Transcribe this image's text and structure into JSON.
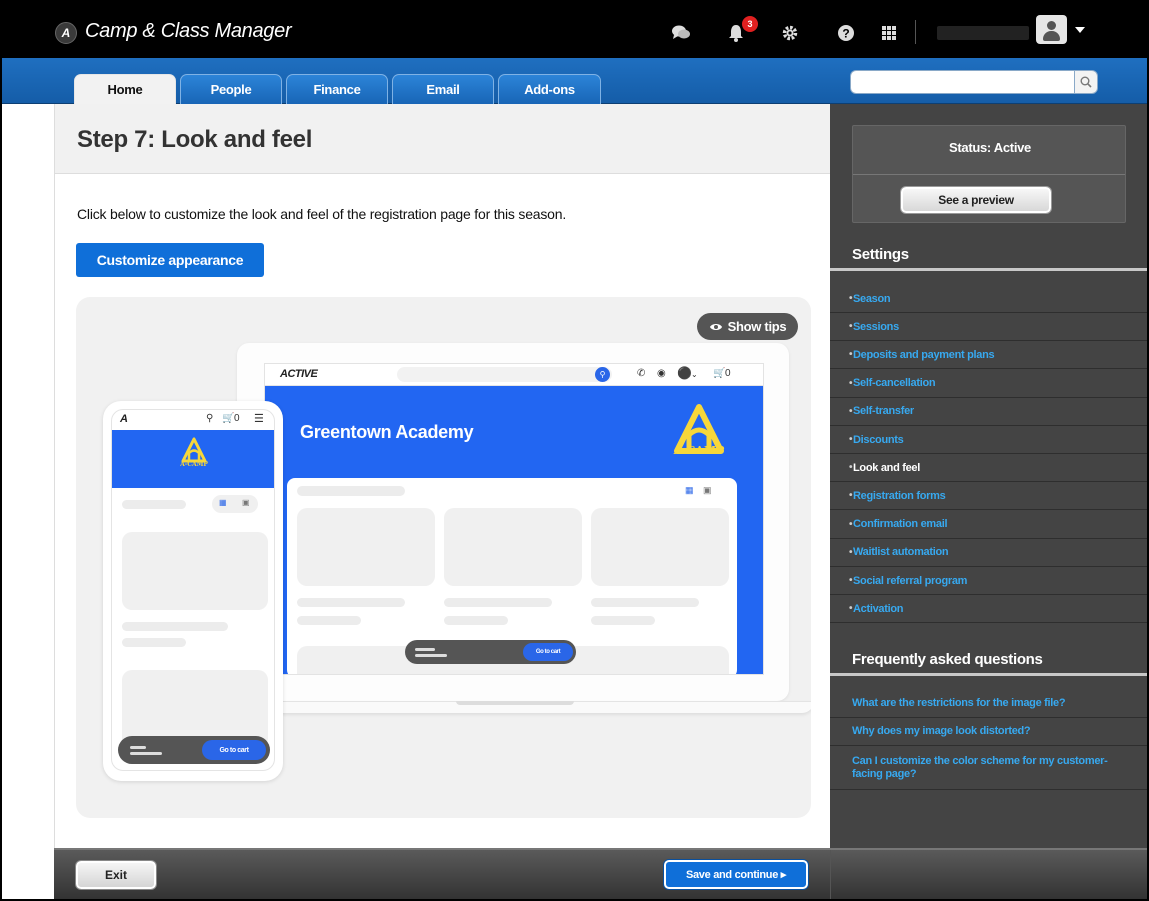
{
  "app": {
    "title": "Camp & Class Manager",
    "logo_letter": "A",
    "notification_count": "3"
  },
  "nav": {
    "tabs": [
      {
        "label": "Home",
        "active": true
      },
      {
        "label": "People"
      },
      {
        "label": "Finance"
      },
      {
        "label": "Email"
      },
      {
        "label": "Add-ons"
      }
    ],
    "search": {
      "placeholder": "",
      "value": ""
    }
  },
  "main": {
    "title": "Step 7: Look and feel",
    "intro": "Click below to customize the look and feel of the registration page for this season.",
    "customize_button": "Customize appearance",
    "show_tips": "Show tips",
    "preview": {
      "brand": "ACTIVE",
      "org_name": "Greentown Academy",
      "logo_text": "A-CAMP",
      "cart_count": "0",
      "go_to_cart_small": "Go to cart",
      "go_to_cart_phone": "Go to cart"
    }
  },
  "sidebar": {
    "status": "Status: Active",
    "preview_button": "See a preview",
    "settings_heading": "Settings",
    "settings_items": [
      {
        "label": "Season"
      },
      {
        "label": "Sessions"
      },
      {
        "label": "Deposits and payment plans"
      },
      {
        "label": "Self-cancellation"
      },
      {
        "label": "Self-transfer"
      },
      {
        "label": "Discounts"
      },
      {
        "label": "Look and feel",
        "current": true
      },
      {
        "label": "Registration forms"
      },
      {
        "label": "Confirmation email"
      },
      {
        "label": "Waitlist automation"
      },
      {
        "label": "Social referral program"
      },
      {
        "label": "Activation"
      }
    ],
    "faq_heading": "Frequently asked questions",
    "faq_items": [
      {
        "label": "What are the restrictions for the image file?"
      },
      {
        "label": "Why does my image look distorted?"
      },
      {
        "label": "Can I customize the color scheme for my customer-facing page?"
      }
    ]
  },
  "footer": {
    "exit": "Exit",
    "save": "Save and continue ▸"
  },
  "colors": {
    "brand_blue": "#0f6fd9",
    "nav_blue": "#1865b6",
    "preview_hero": "#2266f2",
    "link": "#37a9f0",
    "sidebar_bg": "#444444",
    "badge_red": "#e02020",
    "logo_yellow": "#f7d73a"
  },
  "icons": [
    "chat-icon",
    "bell-icon",
    "gear-icon",
    "help-icon",
    "apps-grid-icon",
    "user-avatar-icon",
    "caret-down-icon",
    "search-icon",
    "eye-icon"
  ]
}
